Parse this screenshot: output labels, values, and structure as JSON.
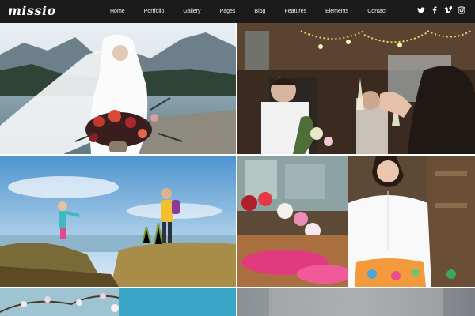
{
  "header": {
    "logo_text": "missio",
    "nav": [
      {
        "label": "Home"
      },
      {
        "label": "Portfolio"
      },
      {
        "label": "Gallery"
      },
      {
        "label": "Pages"
      },
      {
        "label": "Blog"
      },
      {
        "label": "Features"
      },
      {
        "label": "Elements"
      },
      {
        "label": "Contact"
      }
    ],
    "social_icons": [
      "twitter-icon",
      "facebook-icon",
      "vimeo-icon",
      "instagram-icon"
    ]
  },
  "gallery": {
    "photos": [
      {
        "subject": "bride-with-bouquet"
      },
      {
        "subject": "wedding-toast"
      },
      {
        "subject": "mother-and-child"
      },
      {
        "subject": "flower-market"
      },
      {
        "subject": "blossom-branch"
      },
      {
        "subject": "grey-blur"
      }
    ]
  },
  "colors": {
    "nav_background": "#1b1b1b",
    "nav_text": "#f2f2f2"
  }
}
